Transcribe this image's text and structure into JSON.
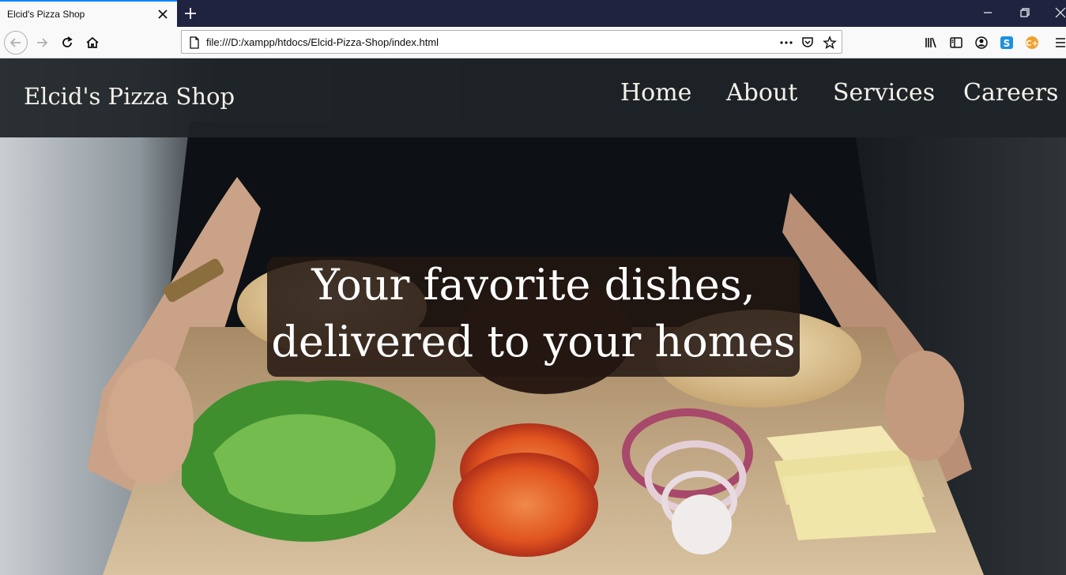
{
  "browser": {
    "tab_title": "Elcid's Pizza Shop",
    "url": "file:///D:/xampp/htdocs/Elcid-Pizza-Shop/index.html"
  },
  "site": {
    "brand": "Elcid's Pizza Shop",
    "nav": [
      {
        "label": "Home"
      },
      {
        "label": "About"
      },
      {
        "label": "Services"
      },
      {
        "label": "Careers"
      }
    ]
  },
  "hero": {
    "line1": "Your favorite dishes,",
    "line2": "delivered to your homes"
  },
  "colors": {
    "tab_accent": "#0a84ff",
    "titlebar": "#202340",
    "header_bg": "#1e2428",
    "hero_box": "#231612"
  }
}
